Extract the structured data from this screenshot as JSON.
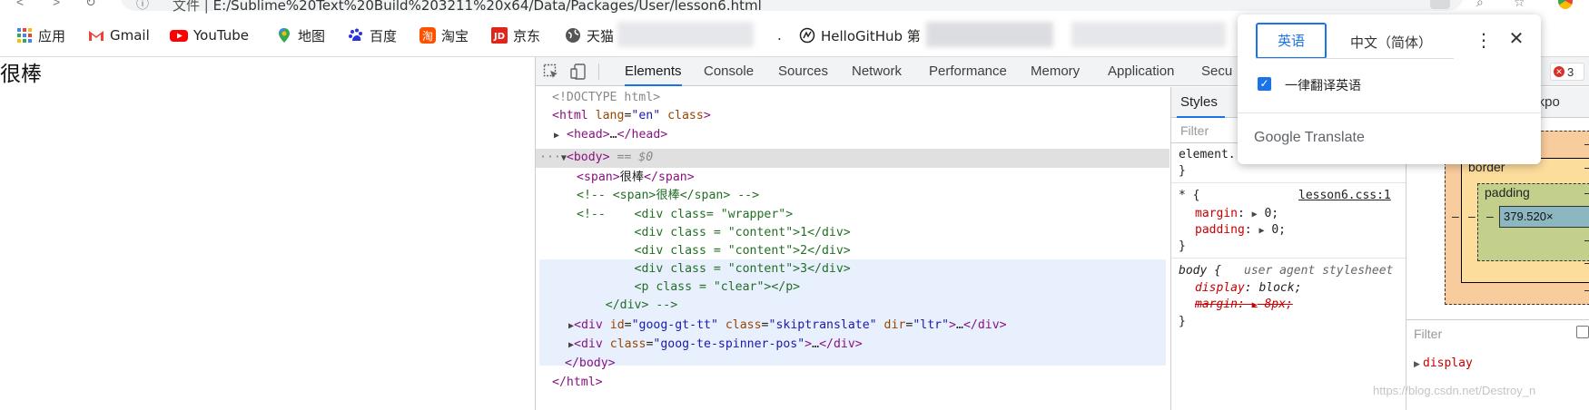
{
  "browser": {
    "address_prefix": "文件 | ",
    "address_path": "E:/Sublime%20Text%20Build%203211%20x64/Data/Packages/User/lesson6.html"
  },
  "bookmarks": [
    {
      "label": "应用",
      "icon": "apps-grid-icon"
    },
    {
      "label": "Gmail",
      "icon": "gmail-icon"
    },
    {
      "label": "YouTube",
      "icon": "youtube-icon"
    },
    {
      "label": "地图",
      "icon": "maps-pin-icon"
    },
    {
      "label": "百度",
      "icon": "baidu-paw-icon"
    },
    {
      "label": "淘宝",
      "icon": "taobao-icon"
    },
    {
      "label": "京东",
      "icon": "jd-icon"
    },
    {
      "label": "天猫",
      "icon": "globe-icon"
    },
    {
      "label": ".",
      "icon": ""
    },
    {
      "label": "HelloGitHub 第",
      "icon": "github-icon"
    }
  ],
  "page": {
    "content_text": "很棒"
  },
  "devtools": {
    "tabs": [
      "Elements",
      "Console",
      "Sources",
      "Network",
      "Performance",
      "Memory",
      "Application",
      "Secu"
    ],
    "active_tab": "Elements",
    "error_count": "3",
    "elements_lines": {
      "doctype": "<!DOCTYPE html>",
      "html_open_tag": "html",
      "html_attr1_name": "lang",
      "html_attr1_value": "\"en\"",
      "html_attr2_name": "class",
      "head_tag": "head",
      "head_ellipsis": "…",
      "body_tag": "body",
      "body_selected_marker": " == $0",
      "span_tag": "span",
      "span_text": "很棒",
      "comment_line1": "<!-- <span>很棒</span> -->",
      "comment_line2": "<!--    <div class= \"wrapper\">",
      "comment_line3": "        <div class = \"content\">1</div>",
      "comment_line4": "        <div class = \"content\">2</div>",
      "comment_line5": "        <div class = \"content\">3</div>",
      "comment_line6": "        <p class = \"clear\"></p>",
      "comment_line7": "    </div> -->",
      "div1_tag": "div",
      "div1_id_attr": "id",
      "div1_id_value": "\"goog-gt-tt\"",
      "div1_class_attr": "class",
      "div1_class_value": "\"skiptranslate\"",
      "div1_dir_attr": "dir",
      "div1_dir_value": "\"ltr\"",
      "div2_tag": "div",
      "div2_class_attr": "class",
      "div2_class_value": "\"goog-te-spinner-pos\"",
      "body_close": "</body>",
      "html_close": "</html>",
      "ellipsis": "…"
    },
    "styles": {
      "tab_label": "Styles",
      "filter_placeholder": "Filter",
      "rule1_selector": "element.",
      "rule2_selector": "* {",
      "rule2_source": "lesson6.css:1",
      "rule2_prop1": "margin",
      "rule2_val1": "0;",
      "rule2_prop2": "padding",
      "rule2_val2": "0;",
      "rule3_selector": "body {",
      "rule3_source": "user agent stylesheet",
      "rule3_prop1": "display",
      "rule3_val1": "block;",
      "rule3_prop2": "margin",
      "rule3_val2": "8px;",
      "close_brace": "}"
    },
    "computed": {
      "breakpoints_label": "reakpo",
      "border_label": "border",
      "padding_label": "padding",
      "content_size": "379.520×",
      "dash": "–",
      "filter_placeholder": "Filter",
      "display_prop": "display"
    }
  },
  "translate_popup": {
    "source_lang": "英语",
    "target_lang": "中文（简体）",
    "checkbox_label": "一律翻译英语",
    "checkbox_checked": true,
    "brand": "Google Translate"
  },
  "watermark": "https://blog.csdn.net/Destroy_n"
}
